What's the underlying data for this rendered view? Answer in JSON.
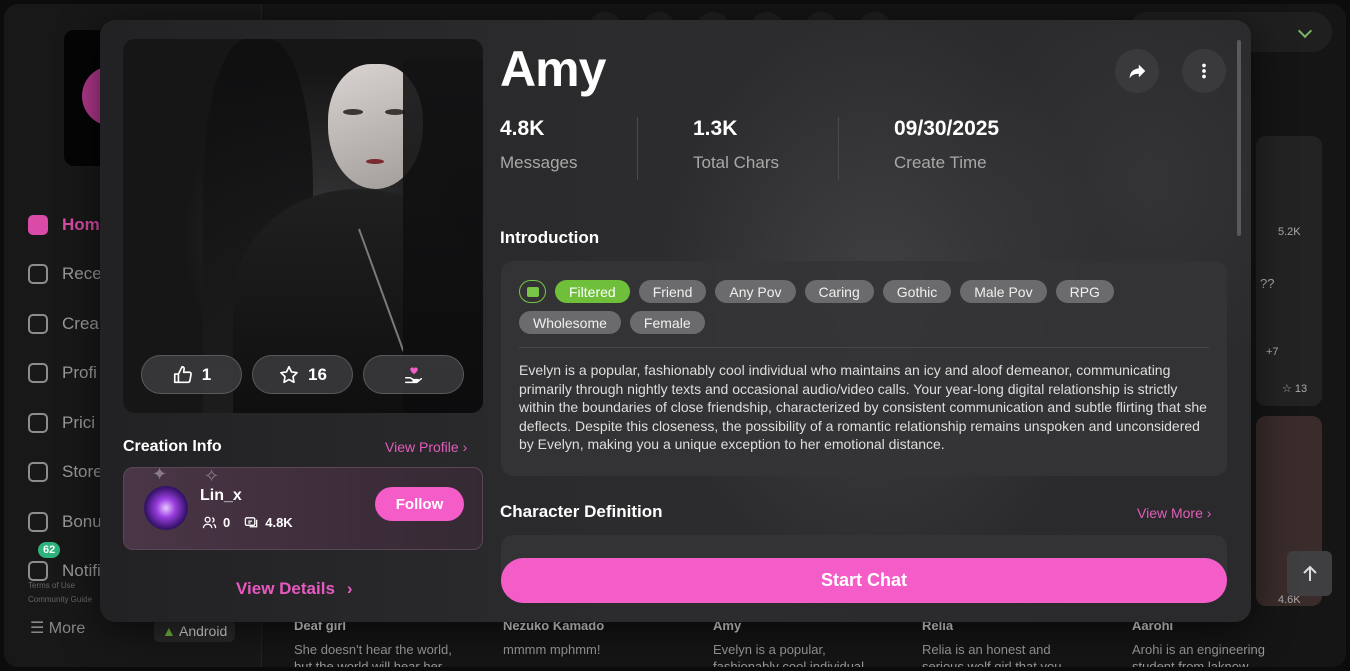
{
  "background": {
    "nav": [
      {
        "label": "Hom",
        "active": true
      },
      {
        "label": "Rece"
      },
      {
        "label": "Crea"
      },
      {
        "label": "Profi"
      },
      {
        "label": "Prici"
      },
      {
        "label": "Store"
      },
      {
        "label": "Bonu"
      },
      {
        "label": "Notifi"
      }
    ],
    "notification_count": "62",
    "terms": "Terms of Use",
    "guide": "Community Guide",
    "more": "More",
    "android": "Android",
    "cards": [
      {
        "title": "Deaf girl",
        "desc": "She doesn't hear the world, but the world will hear her"
      },
      {
        "title": "Nezuko Kamado",
        "desc": "mmmm mphmm!"
      },
      {
        "title": "Amy",
        "desc": "Evelyn is a popular, fashionably cool individual"
      },
      {
        "title": "Relia",
        "desc": "Relia is an honest and serious wolf girl that you"
      },
      {
        "title": "Aarohi",
        "desc": "Arohi is an engineering student from laknow"
      }
    ],
    "side_stats": {
      "chars_a": "5.2K",
      "q": "??",
      "plus": "+7",
      "stars": "13",
      "chars_b": "4.6K"
    }
  },
  "modal": {
    "name": "Amy",
    "reactions": {
      "likes": "1",
      "favorites": "16"
    },
    "stats": [
      {
        "value": "4.8K",
        "label": "Messages"
      },
      {
        "value": "1.3K",
        "label": "Total Chars"
      },
      {
        "value": "09/30/2025",
        "label": "Create Time"
      }
    ],
    "creation_info_title": "Creation Info",
    "view_profile": "View Profile",
    "creator": {
      "name": "Lin_x",
      "followers": "0",
      "chats": "4.8K",
      "follow_label": "Follow"
    },
    "view_details": "View Details",
    "introduction_title": "Introduction",
    "tags": [
      "Filtered",
      "Friend",
      "Any Pov",
      "Caring",
      "Gothic",
      "Male Pov",
      "RPG",
      "Wholesome",
      "Female"
    ],
    "introduction": "Evelyn is a popular, fashionably cool individual who maintains an icy and aloof demeanor, communicating primarily through nightly texts and occasional audio/video calls. Your year-long digital relationship is strictly within the boundaries of close friendship, characterized by consistent communication and subtle flirting that she deflects. Despite this closeness, the possibility of a romantic relationship remains unspoken and unconsidered by Evelyn, making you a unique exception to her emotional distance.",
    "definition_title": "Character Definition",
    "view_more": "View More",
    "start_chat": "Start Chat"
  },
  "colors": {
    "accent": "#f45cc8",
    "filtered": "#6fbf3a"
  }
}
